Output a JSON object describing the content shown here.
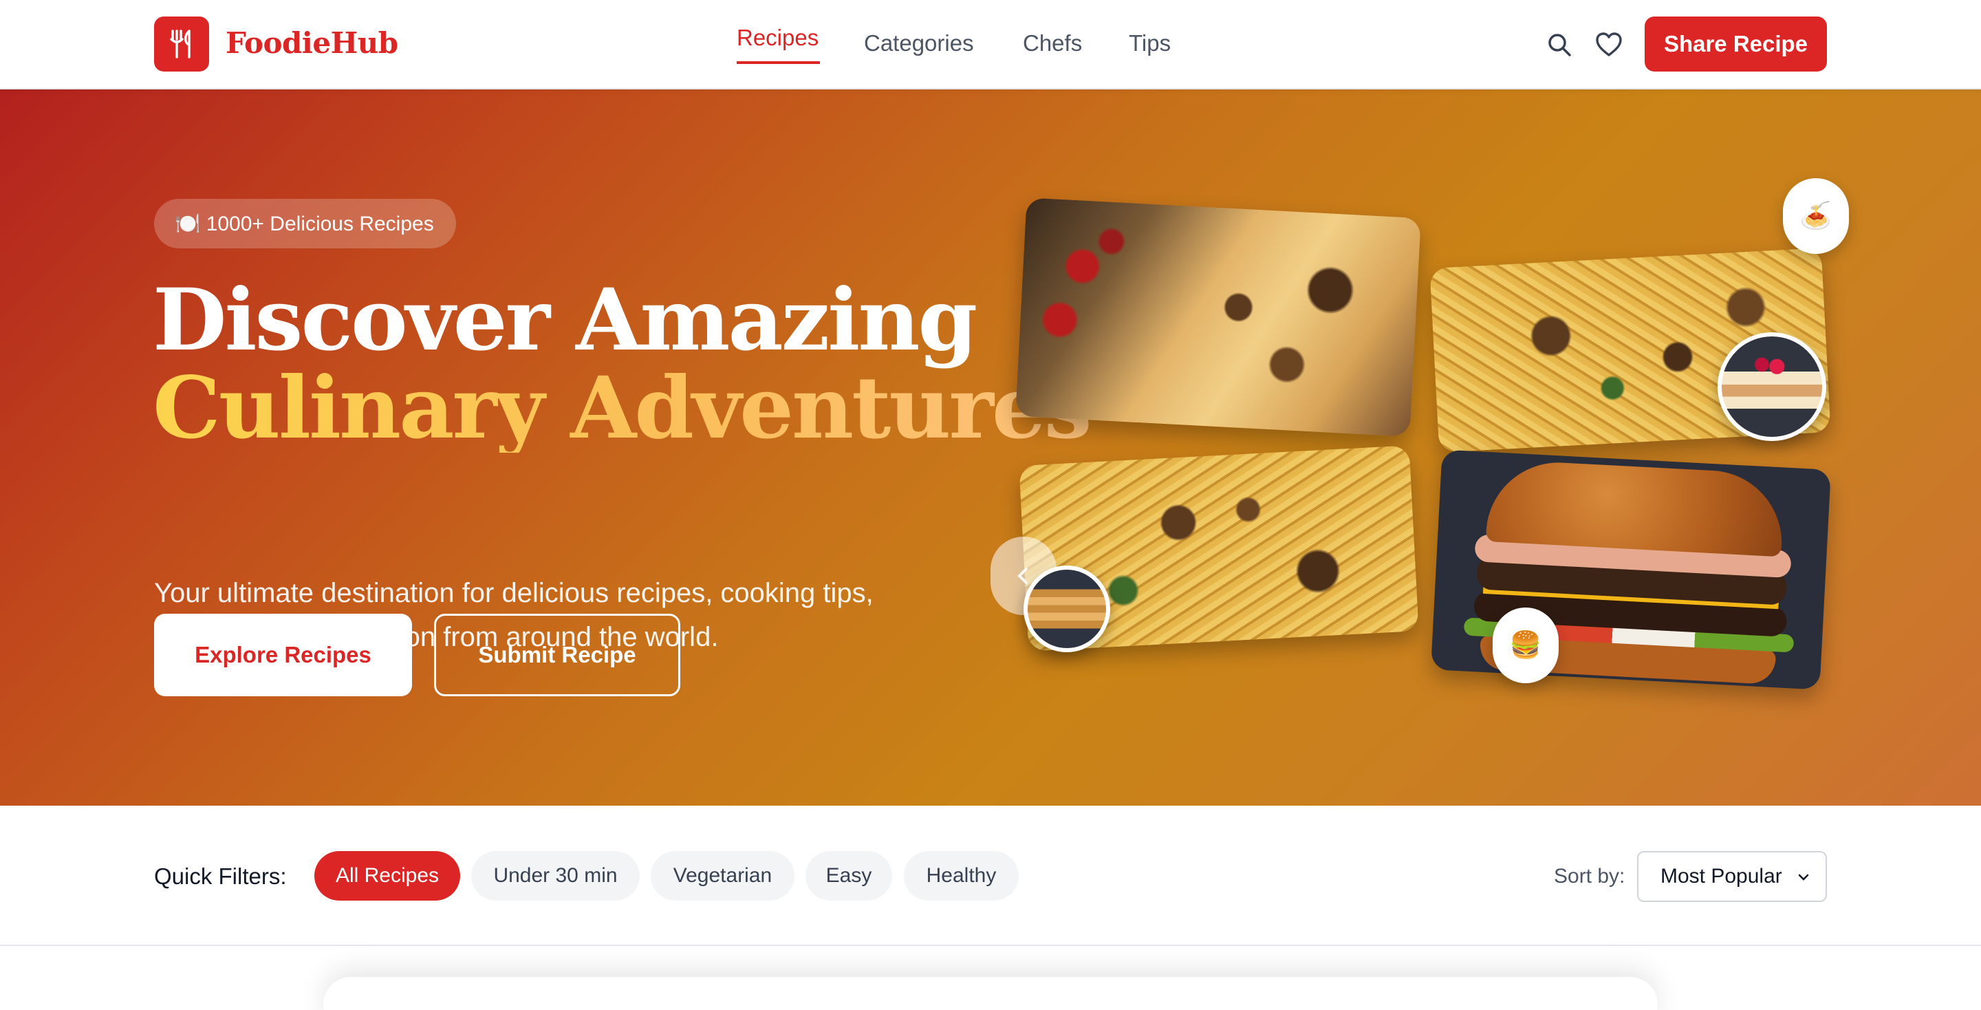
{
  "nav": {
    "brand": "FoodieHub",
    "links": [
      {
        "label": "Recipes",
        "active": true
      },
      {
        "label": "Categories",
        "active": false
      },
      {
        "label": "Chefs",
        "active": false
      },
      {
        "label": "Tips",
        "active": false
      }
    ],
    "share_label": "Share Recipe",
    "icons": [
      "utensils-icon",
      "search-icon",
      "heart-icon"
    ],
    "accent_color": "#dc2626"
  },
  "hero": {
    "badge": "🍽️ 1000+ Delicious Recipes",
    "title_line1": "Discover Amazing",
    "title_line2": "Culinary Adventures",
    "subtitle_line1": "Your ultimate destination for delicious recipes, cooking tips,",
    "subtitle_line2": "and culinary inspiration from around the world.",
    "primary_cta": "Explore Recipes",
    "secondary_cta": "Submit Recipe",
    "floating_emojis": {
      "spaghetti": "🍝",
      "burger": "🍔"
    },
    "gradient": [
      "#b3211e",
      "#c7721a",
      "#cd7034"
    ],
    "accent_gold": "#fcd34d"
  },
  "filters": {
    "label": "Quick Filters:",
    "chips": [
      {
        "label": "All Recipes",
        "active": true
      },
      {
        "label": "Under 30 min",
        "active": false
      },
      {
        "label": "Vegetarian",
        "active": false
      },
      {
        "label": "Easy",
        "active": false
      },
      {
        "label": "Healthy",
        "active": false
      }
    ],
    "sort_label": "Sort by:",
    "sort_value": "Most Popular"
  }
}
